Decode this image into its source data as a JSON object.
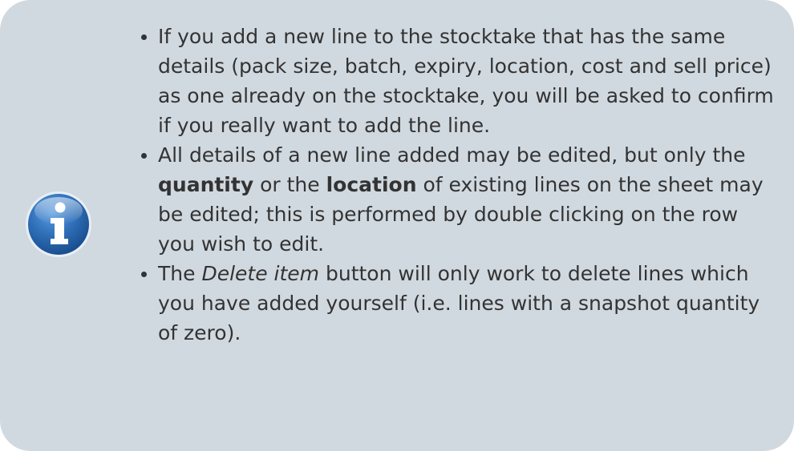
{
  "note": {
    "icon": "info-icon",
    "colors": {
      "background": "#d1d9e0",
      "text": "#333333",
      "icon_blue": "#2f6fb8"
    },
    "items": [
      {
        "text": "If you add a new line to the stocktake that has the same details (pack size, batch, expiry, location, cost and sell price) as one already on the stocktake, you will be asked to confirm if you really want to add the line."
      },
      {
        "text_1": "All details of a new line added may be edited, but only the ",
        "bold_1": "quantity",
        "text_2": " or the ",
        "bold_2": "location",
        "text_3": " of existing lines on the sheet may be edited; this is performed by double clicking on the row you wish to edit."
      },
      {
        "text_1": "The ",
        "italic_1": "Delete item",
        "text_2": " button will only work to delete lines which you have added yourself (i.e. lines with a snapshot quantity of zero)."
      }
    ]
  }
}
